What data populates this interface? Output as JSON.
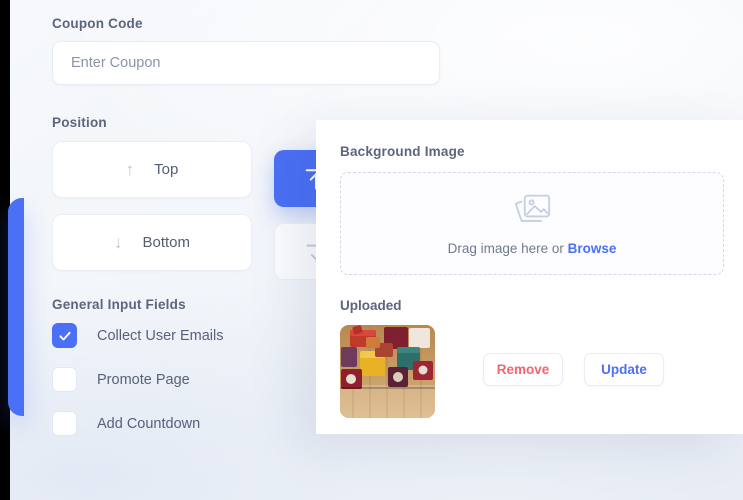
{
  "theme": {
    "accent": "#4b70f5",
    "danger": "#f4646e",
    "surface": "#ffffff",
    "page_bg": "#f3f6fa",
    "label_color": "#5b657d"
  },
  "form": {
    "coupon": {
      "label": "Coupon Code",
      "placeholder": "Enter Coupon",
      "value": ""
    },
    "position": {
      "label": "Position",
      "options": [
        {
          "label": "Top",
          "icon": "arrow-up-icon",
          "glyph": "↑",
          "selected": false
        },
        {
          "label": "Bottom",
          "icon": "arrow-down-icon",
          "glyph": "↓",
          "selected": false
        }
      ]
    },
    "general_input_fields": {
      "label": "General Input Fields",
      "items": [
        {
          "label": "Collect User Emails",
          "checked": true
        },
        {
          "label": "Promote Page",
          "checked": false
        },
        {
          "label": "Add Countdown",
          "checked": false
        }
      ]
    }
  },
  "modal": {
    "background_image": {
      "label": "Background Image",
      "dropzone": {
        "icon": "image-placeholder-icon",
        "text": "Drag image here or ",
        "browse_label": "Browse"
      }
    },
    "uploaded": {
      "label": "Uploaded",
      "thumbnail_name": "uploaded-image-thumbnail",
      "actions": [
        {
          "label": "Remove",
          "kind": "danger"
        },
        {
          "label": "Update",
          "kind": "accent"
        }
      ]
    }
  }
}
